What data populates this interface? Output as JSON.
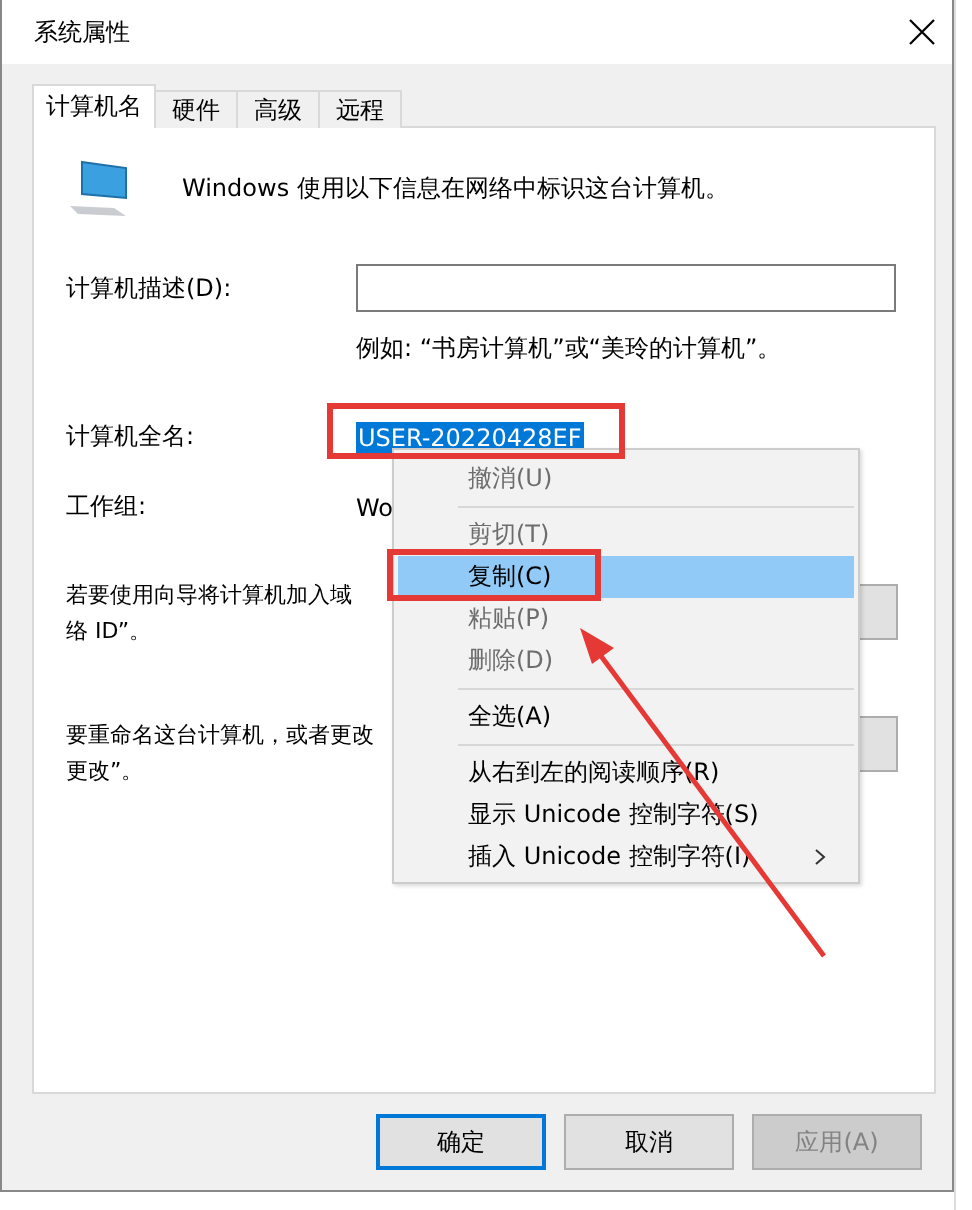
{
  "window": {
    "title": "系统属性"
  },
  "tabs": [
    {
      "label": "计算机名",
      "selected": true
    },
    {
      "label": "硬件",
      "selected": false
    },
    {
      "label": "高级",
      "selected": false
    },
    {
      "label": "远程",
      "selected": false
    }
  ],
  "intro": "Windows 使用以下信息在网络中标识这台计算机。",
  "description": {
    "label": "计算机描述(D):",
    "example": "例如: “书房计算机”或“美玲的计算机”。"
  },
  "full_name": {
    "label": "计算机全名:",
    "value": "USER-20220428EF",
    "selected": true
  },
  "workgroup": {
    "label": "工作组:",
    "value": "Wo"
  },
  "network_text": [
    "若要使用向导将计算机加入域",
    "络 ID”。"
  ],
  "rename_text": [
    "要重命名这台计算机，或者更改",
    "更改”。"
  ],
  "context_menu": [
    {
      "kind": "item",
      "label": "撤消(U)",
      "disabled": true,
      "selected": false
    },
    {
      "kind": "separator"
    },
    {
      "kind": "item",
      "label": "剪切(T)",
      "disabled": true,
      "selected": false
    },
    {
      "kind": "item",
      "label": "复制(C)",
      "disabled": false,
      "selected": true
    },
    {
      "kind": "item",
      "label": "粘贴(P)",
      "disabled": true,
      "selected": false
    },
    {
      "kind": "item",
      "label": "删除(D)",
      "disabled": true,
      "selected": false
    },
    {
      "kind": "separator"
    },
    {
      "kind": "item",
      "label": "全选(A)",
      "disabled": false,
      "selected": false
    },
    {
      "kind": "separator"
    },
    {
      "kind": "item",
      "label": "从右到左的阅读顺序(R)",
      "disabled": false,
      "selected": false
    },
    {
      "kind": "item",
      "label": "显示 Unicode 控制字符(S)",
      "disabled": false,
      "selected": false
    },
    {
      "kind": "submenu",
      "label": "插入 Unicode 控制字符(I)",
      "disabled": false,
      "selected": false
    }
  ],
  "buttons": [
    {
      "label": "确定",
      "default": true,
      "disabled": false
    },
    {
      "label": "取消",
      "default": false,
      "disabled": false
    },
    {
      "label": "应用(A)",
      "default": false,
      "disabled": true
    }
  ],
  "annotations": [
    {
      "kind": "box"
    },
    {
      "kind": "box"
    },
    {
      "kind": "arrow"
    }
  ]
}
